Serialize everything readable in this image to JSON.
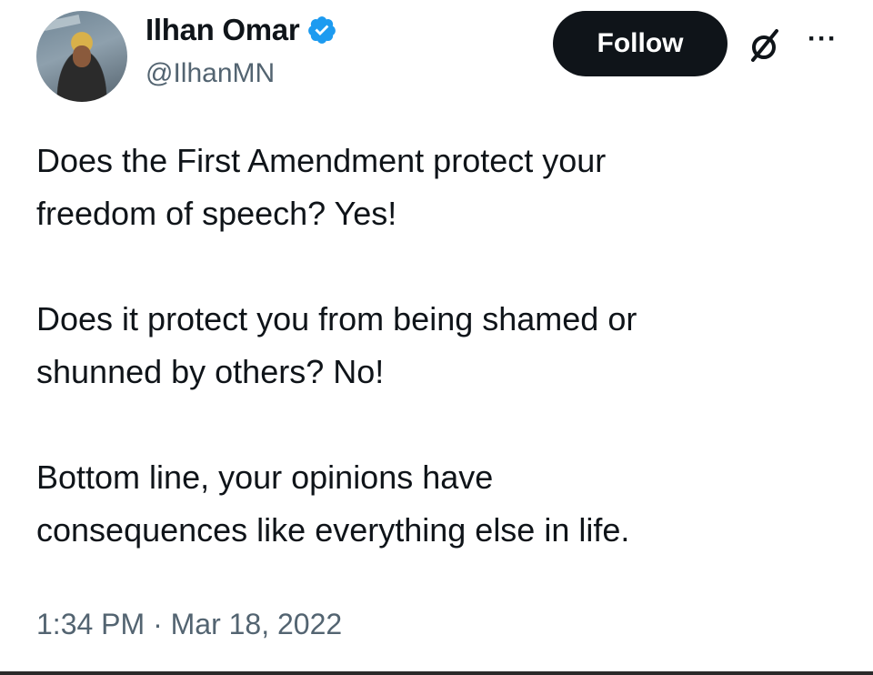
{
  "author": {
    "display_name": "Ilhan Omar",
    "handle": "@IlhanMN",
    "verified": true,
    "avatar_icon": "profile-photo"
  },
  "actions": {
    "follow_label": "Follow",
    "grok_icon": "grok-icon",
    "more_label": "···"
  },
  "tweet": {
    "paragraphs": [
      [
        "Does the First Amendment protect your",
        "freedom of speech? Yes!"
      ],
      [
        "Does it protect you from being shamed or",
        "shunned by others? No!"
      ],
      [
        "Bottom line, your opinions have",
        "consequences like everything else in life."
      ]
    ],
    "timestamp": "1:34 PM · Mar 18, 2022"
  },
  "colors": {
    "text": "#0f1419",
    "secondary": "#536471",
    "verified_blue": "#1d9bf0",
    "follow_bg": "#0f1419"
  }
}
